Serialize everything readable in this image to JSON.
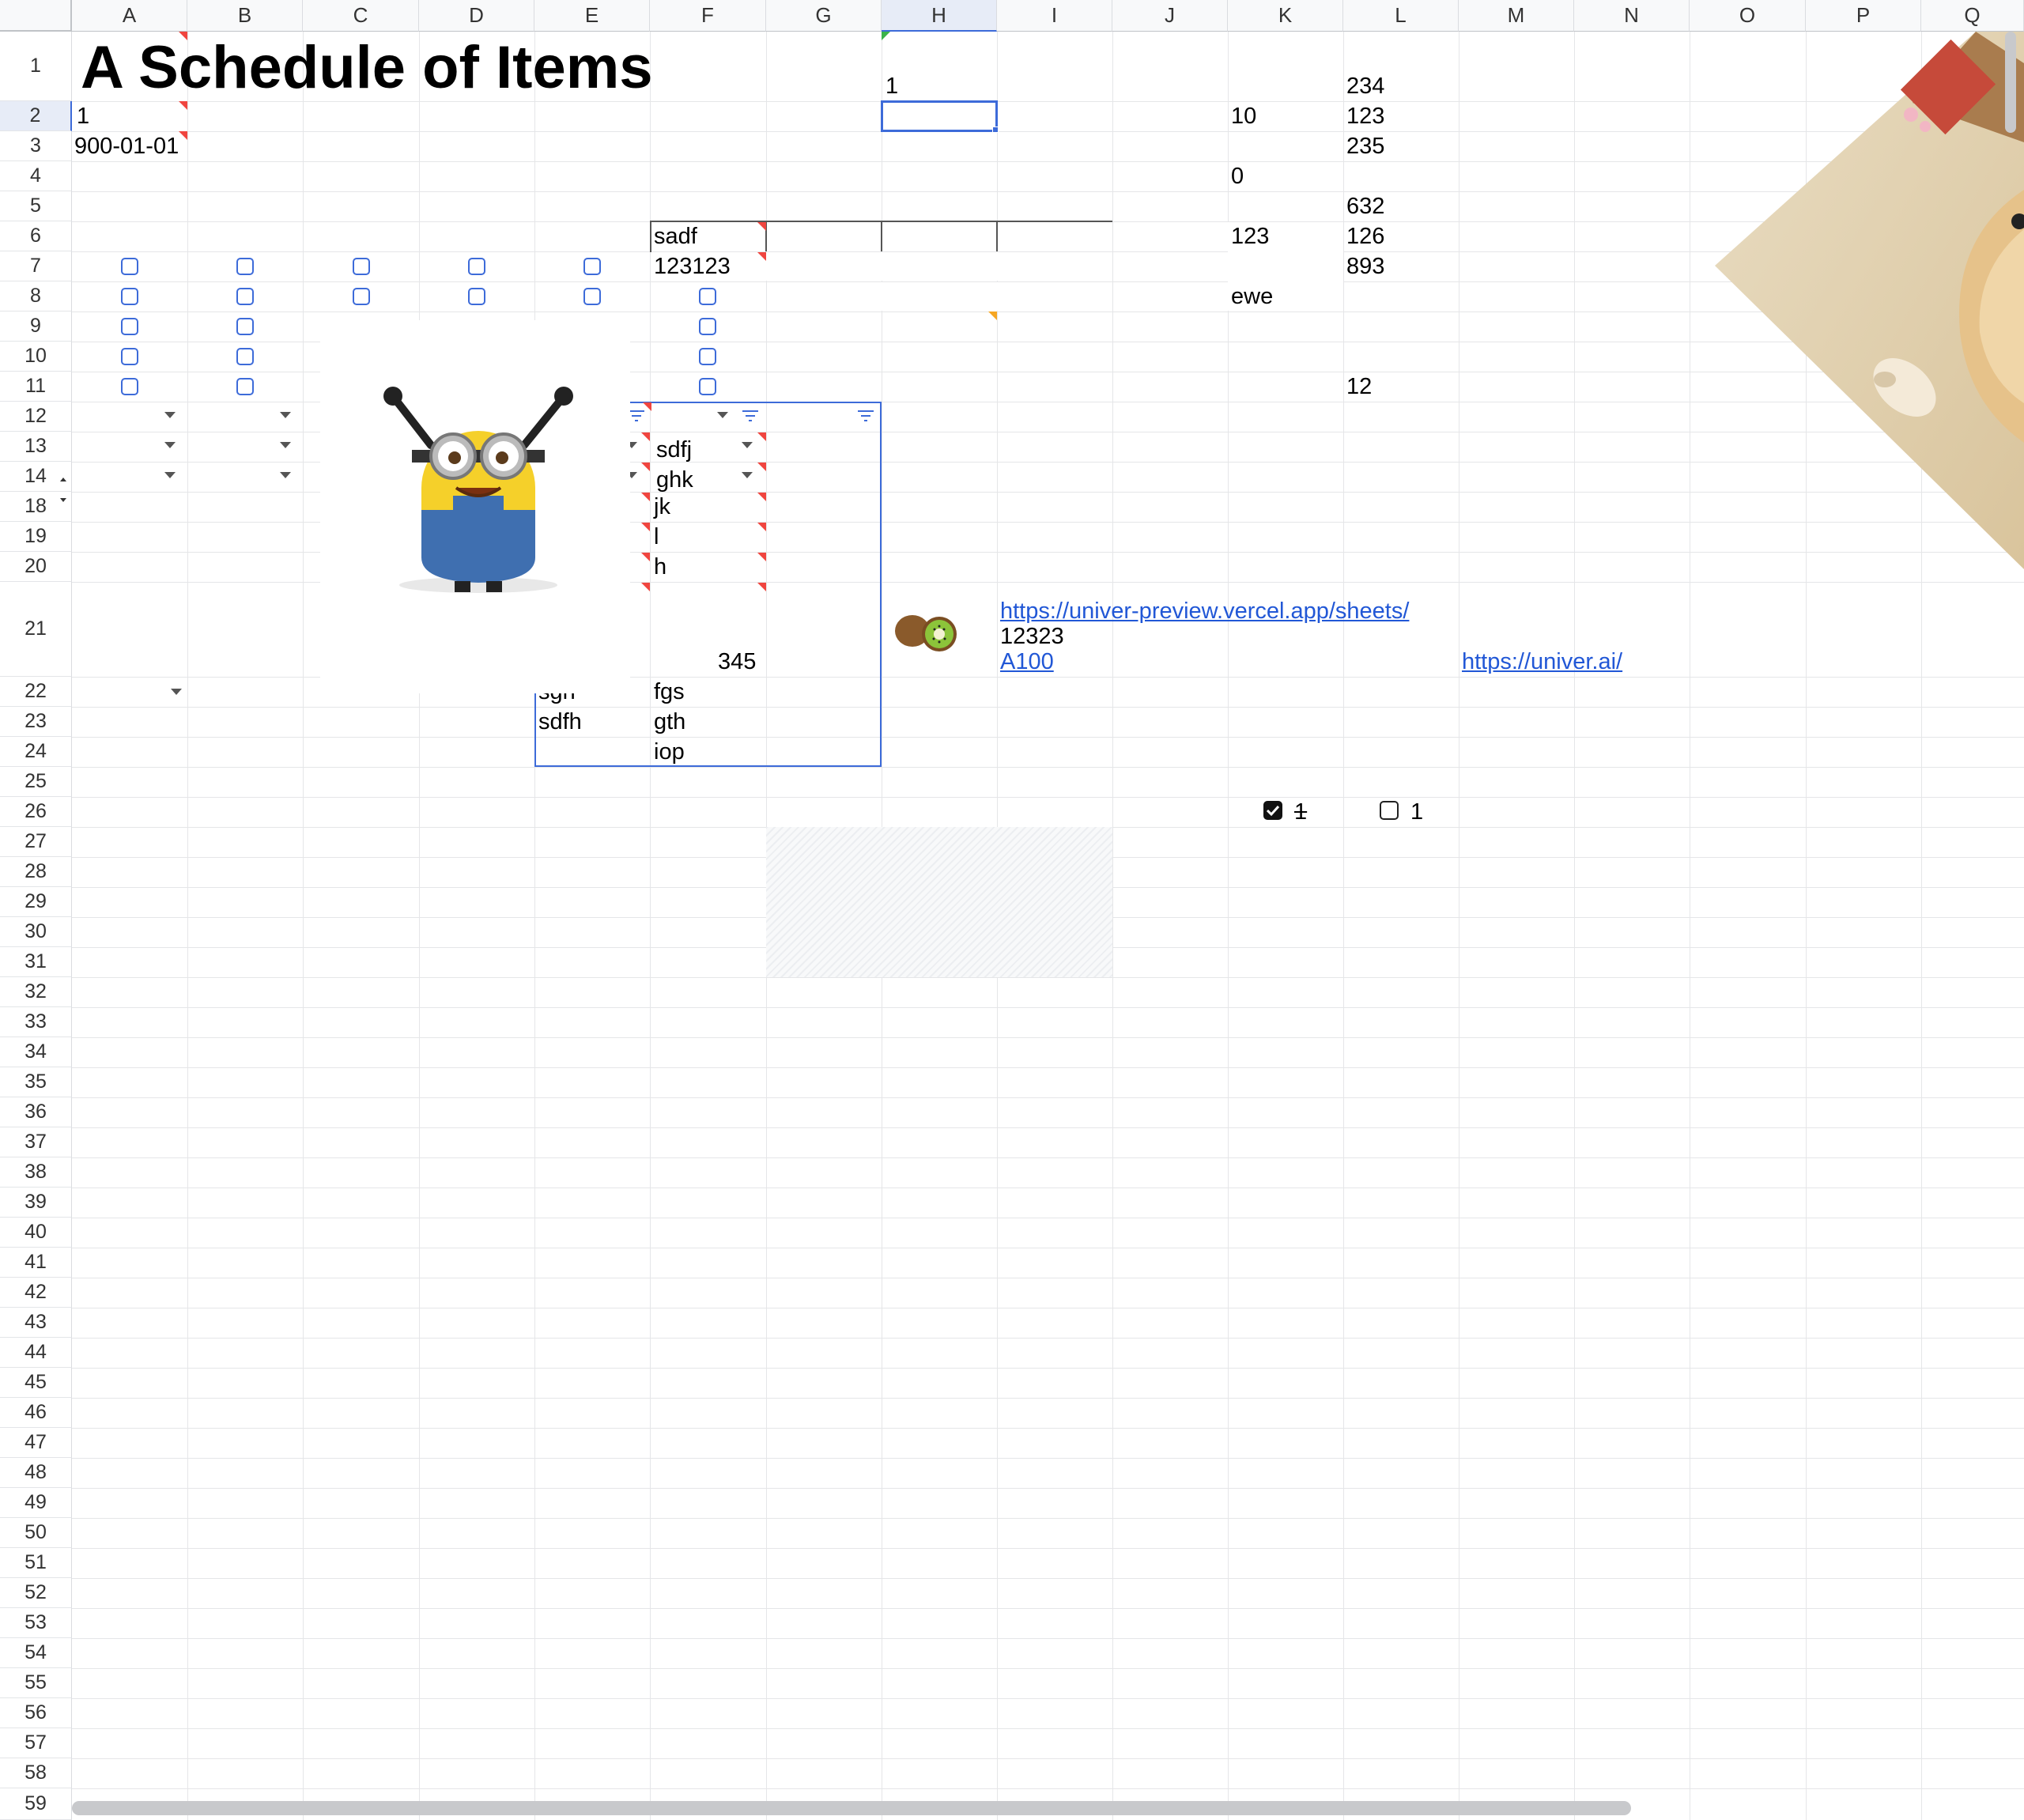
{
  "columns": [
    "A",
    "B",
    "C",
    "D",
    "E",
    "F",
    "G",
    "H",
    "I",
    "J",
    "K",
    "L",
    "M",
    "N",
    "O",
    "P",
    "Q"
  ],
  "rows": [
    "1",
    "2",
    "3",
    "4",
    "5",
    "6",
    "7",
    "8",
    "9",
    "10",
    "11",
    "12",
    "13",
    "14",
    "18",
    "19",
    "20",
    "21",
    "22",
    "23",
    "24",
    "25",
    "26",
    "27",
    "28",
    "29",
    "30",
    "31",
    "32",
    "33",
    "34",
    "35",
    "36",
    "37",
    "38",
    "39",
    "40",
    "41",
    "42",
    "43",
    "44",
    "45",
    "46",
    "47",
    "48",
    "49",
    "50",
    "51",
    "52",
    "53",
    "54",
    "55",
    "56",
    "57",
    "58",
    "59"
  ],
  "selected_cell": "H2",
  "title": "A Schedule of Items",
  "cells": {
    "A2": "1",
    "A3": "900-01-01",
    "H1": "1",
    "K2": "10",
    "K4": "0",
    "K6": "123",
    "K8": "ewe",
    "L1": "234",
    "L2": "123",
    "L3": "235",
    "L5": "632",
    "L6": "126",
    "L7": "893",
    "L11": "12",
    "F6": "sadf",
    "F7": "123123",
    "F13": "sdfj",
    "F14": "ghk",
    "F18": "jk",
    "F19": "l",
    "F20": "h",
    "F21": "345",
    "E22": "sgh",
    "F22": "fgs",
    "E23": "sdfh",
    "F23": "gth",
    "F24": "iop",
    "I21_line2": "12323",
    "K26": "1",
    "L26": "1"
  },
  "links": {
    "I21_url": "https://univer-preview.vercel.app/sheets/",
    "I21_ref": "A100",
    "M21_url": "https://univer.ai/"
  },
  "checkboxes": {
    "K26_checked": true,
    "L26_checked": false
  },
  "images": {
    "minion": "minion-image",
    "kiwi": "kiwi-image",
    "dog": "dog-photo-image"
  },
  "colors": {
    "accent": "#3d6bd9",
    "link": "#2157d6",
    "comment_marker": "#f0453f",
    "header_bg": "#f8f9fa",
    "grid": "#e5e6e8"
  }
}
